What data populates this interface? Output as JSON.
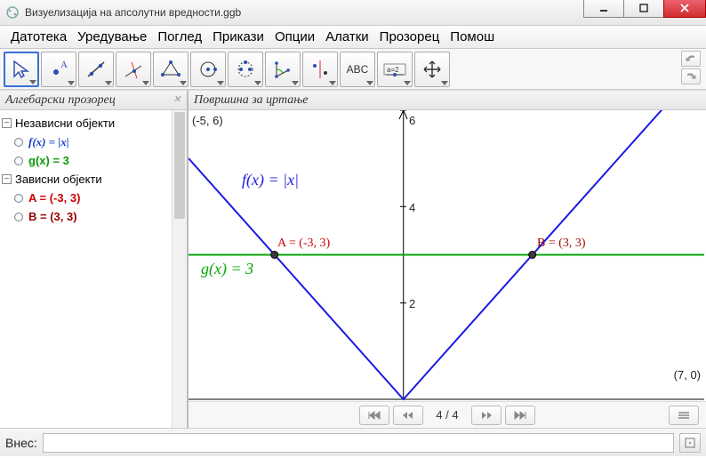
{
  "window": {
    "title": "Визуелизација на апсолутни вредности.ggb"
  },
  "menu": {
    "items": [
      "Датотека",
      "Уредување",
      "Поглед",
      "Прикази",
      "Опции",
      "Алатки",
      "Прозорец",
      "Помош"
    ]
  },
  "panels": {
    "algebra_title": "Алгебарски прозорец",
    "graph_title": "Површина за цртање"
  },
  "algebra": {
    "cat1": "Независни објекти",
    "cat2": "Зависни објекти",
    "f_label": "f(x)  =  |x|",
    "g_label": "g(x) = 3",
    "A_label": "A = (-3, 3)",
    "B_label": "B = (3, 3)"
  },
  "graph": {
    "corner_tl": "(-5, 6)",
    "corner_br": "(7, 0)",
    "f_formula": "f(x)  =  |x|",
    "g_formula": "g(x)  =  3",
    "A_pt": "A = (-3, 3)",
    "B_pt": "B = (3, 3)",
    "tick2": "2",
    "tick4": "4",
    "tick6": "6"
  },
  "steps": {
    "label": "4 / 4"
  },
  "input": {
    "label": "Внес:",
    "value": ""
  },
  "chart_data": {
    "type": "line",
    "title": "",
    "xlabel": "",
    "ylabel": "",
    "xlim": [
      -5,
      7
    ],
    "ylim": [
      0,
      6
    ],
    "series": [
      {
        "name": "f(x) = |x|",
        "color": "#1a1ae6",
        "x": [
          -5,
          0,
          7
        ],
        "y": [
          5,
          0,
          7
        ]
      },
      {
        "name": "g(x) = 3",
        "color": "#0aa50a",
        "x": [
          -5,
          7
        ],
        "y": [
          3,
          3
        ]
      }
    ],
    "points": [
      {
        "name": "A",
        "x": -3,
        "y": 3,
        "color": "#444"
      },
      {
        "name": "B",
        "x": 3,
        "y": 3,
        "color": "#444"
      }
    ],
    "annotations": [
      {
        "text": "A = (-3, 3)",
        "x": -3,
        "y": 3
      },
      {
        "text": "B = (3, 3)",
        "x": 3,
        "y": 3
      }
    ]
  }
}
